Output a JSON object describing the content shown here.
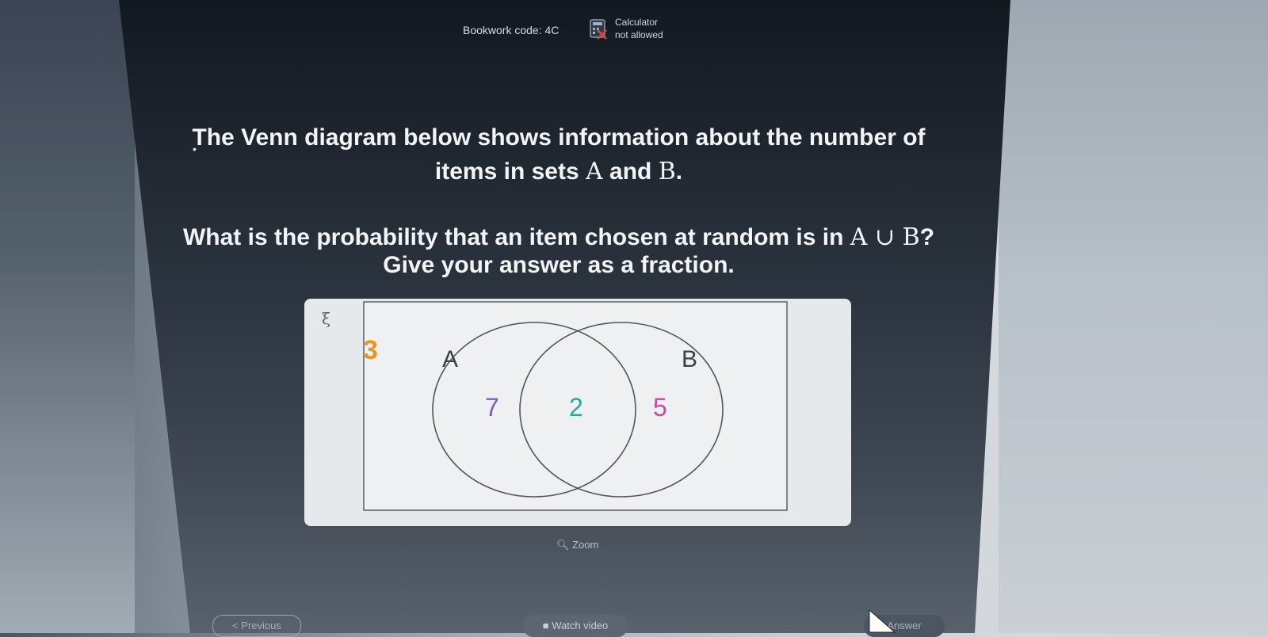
{
  "header": {
    "bookwork": "Bookwork code: 4C",
    "calculator_line1": "Calculator",
    "calculator_line2": "not allowed",
    "calculator_icon": "calculator-crossed-icon"
  },
  "question": {
    "line1": "The Venn diagram below shows information about the number of",
    "line2_pre": "items in sets ",
    "line2_a": "A",
    "line2_mid": " and ",
    "line2_b": "B",
    "line2_post": ".",
    "line3_pre": "What is the probability that an item chosen at random is in ",
    "line3_math": "A ∪ B",
    "line3_post": "?",
    "line4": "Give your answer as a fraction."
  },
  "venn": {
    "universal_symbol": "ξ",
    "label_a": "A",
    "label_b": "B",
    "outside": "3",
    "only_a": "7",
    "intersection": "2",
    "only_b": "5",
    "colors": {
      "outside": "#e8952a",
      "only_a": "#7a5fc0",
      "intersection": "#2aa79b",
      "only_b": "#c44da0",
      "circle": "#50575f"
    }
  },
  "zoom_label": "Zoom",
  "footer": {
    "previous": "< Previous",
    "watch_video": "Watch video",
    "answer": "Answer"
  }
}
